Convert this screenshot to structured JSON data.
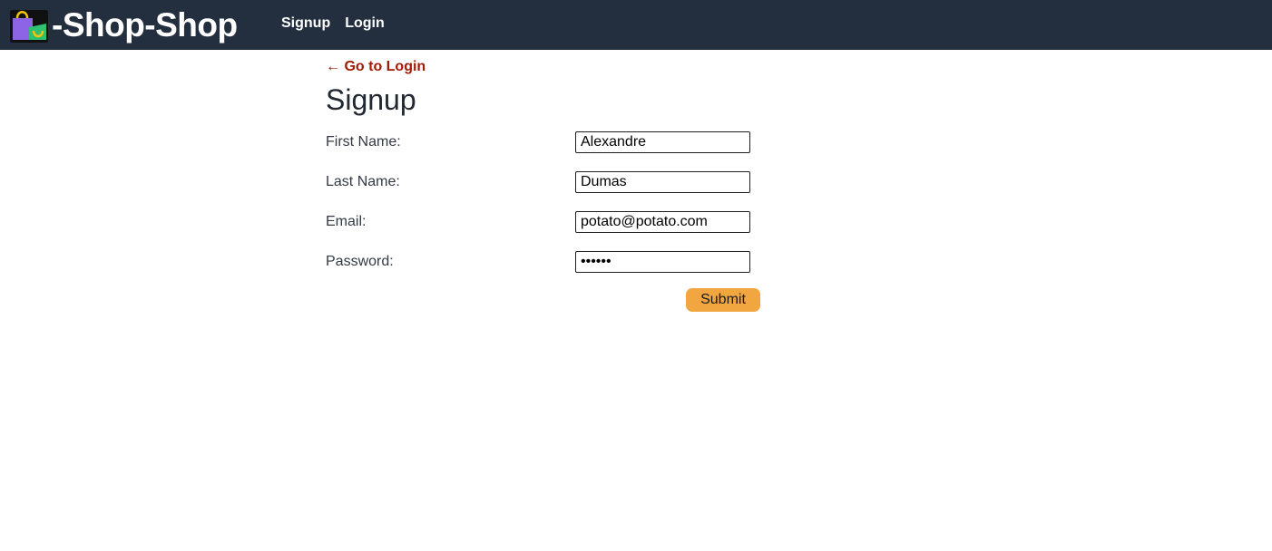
{
  "header": {
    "brand_icon": "shopping-bags-icon",
    "brand_text": "-Shop-Shop",
    "nav": [
      {
        "label": "Signup"
      },
      {
        "label": "Login"
      }
    ],
    "background_color": "#232f3f"
  },
  "main": {
    "back_link": "← Go to Login",
    "back_link_color": "#a11b04",
    "title": "Signup",
    "fields": [
      {
        "label": "First Name:",
        "value": "Alexandre",
        "type": "text"
      },
      {
        "label": "Last Name:",
        "value": "Dumas",
        "type": "text"
      },
      {
        "label": "Email:",
        "value": "potato@potato.com",
        "type": "email"
      },
      {
        "label": "Password:",
        "value": "••••••",
        "type": "password"
      }
    ],
    "submit_label": "Submit",
    "submit_color": "#f1a640"
  }
}
